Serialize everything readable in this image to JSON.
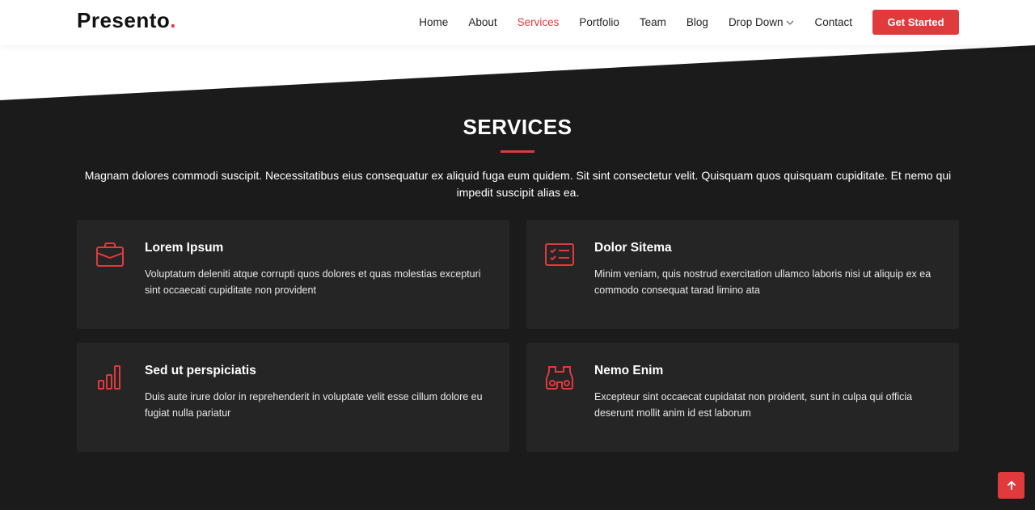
{
  "header": {
    "logo_text": "Presento",
    "logo_dot": ".",
    "nav": [
      "Home",
      "About",
      "Services",
      "Portfolio",
      "Team",
      "Blog",
      "Drop Down",
      "Contact"
    ],
    "cta_label": "Get Started"
  },
  "section": {
    "title": "SERVICES",
    "intro": "Magnam dolores commodi suscipit. Necessitatibus eius consequatur ex aliquid fuga eum quidem. Sit sint consectetur velit. Quisquam quos quisquam cupiditate. Et nemo qui impedit suscipit alias ea."
  },
  "cards": [
    {
      "icon": "briefcase-icon",
      "title": "Lorem Ipsum",
      "desc": "Voluptatum deleniti atque corrupti quos dolores et quas molestias excepturi sint occaecati cupiditate non provident"
    },
    {
      "icon": "card-checklist-icon",
      "title": "Dolor Sitema",
      "desc": "Minim veniam, quis nostrud exercitation ullamco laboris nisi ut aliquip ex ea commodo consequat tarad limino ata"
    },
    {
      "icon": "bar-chart-icon",
      "title": "Sed ut perspiciatis",
      "desc": "Duis aute irure dolor in reprehenderit in voluptate velit esse cillum dolore eu fugiat nulla pariatur"
    },
    {
      "icon": "binoculars-icon",
      "title": "Nemo Enim",
      "desc": "Excepteur sint occaecat cupidatat non proident, sunt in culpa qui officia deserunt mollit anim id est laborum"
    }
  ],
  "colors": {
    "accent": "#e03a3c",
    "background": "#1b1b1c",
    "card": "#252526"
  },
  "back_to_top_icon": "arrow-up-icon"
}
